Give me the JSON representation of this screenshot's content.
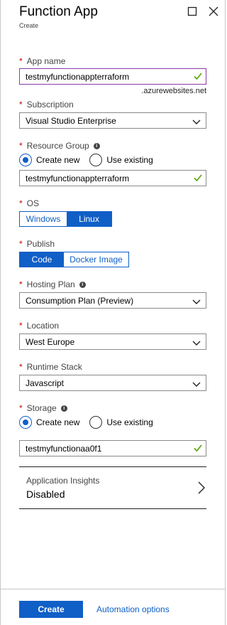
{
  "header": {
    "title": "Function App",
    "subtitle": "Create"
  },
  "app_name": {
    "label": "App name",
    "value": "testmyfunctionappterraform",
    "suffix": ".azurewebsites.net"
  },
  "subscription": {
    "label": "Subscription",
    "value": "Visual Studio Enterprise"
  },
  "resource_group": {
    "label": "Resource Group",
    "option_new": "Create new",
    "option_existing": "Use existing",
    "selected": "Create new",
    "value": "testmyfunctionappterraform"
  },
  "os": {
    "label": "OS",
    "options": [
      "Windows",
      "Linux"
    ],
    "selected": "Linux"
  },
  "publish": {
    "label": "Publish",
    "options": [
      "Code",
      "Docker Image"
    ],
    "selected": "Code"
  },
  "hosting_plan": {
    "label": "Hosting Plan",
    "value": "Consumption Plan (Preview)"
  },
  "location": {
    "label": "Location",
    "value": "West Europe"
  },
  "runtime_stack": {
    "label": "Runtime Stack",
    "value": "Javascript"
  },
  "storage": {
    "label": "Storage",
    "option_new": "Create new",
    "option_existing": "Use existing",
    "selected": "Create new",
    "value": "testmyfunctionaa0f1"
  },
  "app_insights": {
    "label": "Application Insights",
    "value": "Disabled"
  },
  "footer": {
    "create_label": "Create",
    "automation_label": "Automation options"
  },
  "required_marker": "*",
  "colors": {
    "accent": "#0f5fc7",
    "success_check": "#57a300",
    "required": "#cc0000",
    "focus_border": "#8a3aa5"
  },
  "icons": {
    "maximize": "square-icon",
    "close": "close-icon",
    "info": "info-icon",
    "valid": "checkmark-icon",
    "dropdown": "chevron-down-icon",
    "navigate": "chevron-right-icon"
  }
}
